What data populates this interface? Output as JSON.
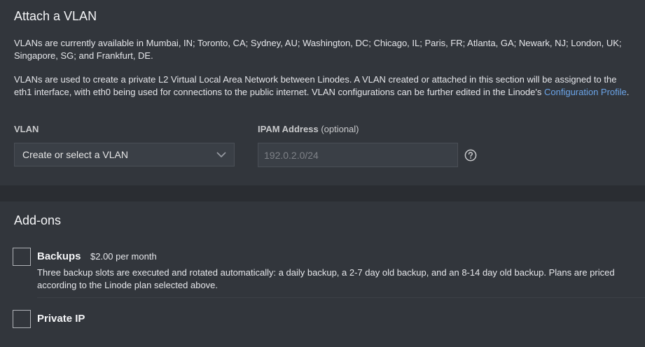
{
  "vlan": {
    "title": "Attach a VLAN",
    "availability": "VLANs are currently available in Mumbai, IN; Toronto, CA; Sydney, AU; Washington, DC; Chicago, IL; Paris, FR; Atlanta, GA; Newark, NJ; London, UK; Singapore, SG; and Frankfurt, DE.",
    "description": "VLANs are used to create a private L2 Virtual Local Area Network between Linodes. A VLAN created or attached in this section will be assigned to the eth1 interface, with eth0 being used for connections to the public internet. VLAN configurations can be further edited in the Linode's",
    "config_link": "Configuration Profile",
    "period": ".",
    "vlan_label": "VLAN",
    "select_value": "Create or select a VLAN",
    "ipam_label": "IPAM Address",
    "ipam_optional": "(optional)",
    "ipam_placeholder": "192.0.2.0/24"
  },
  "addons": {
    "title": "Add-ons",
    "backups": {
      "label": "Backups",
      "price": "$2.00 per month",
      "description": "Three backup slots are executed and rotated automatically: a daily backup, a 2-7 day old backup, and an 8-14 day old backup. Plans are priced according to the Linode plan selected above.",
      "checked": false
    },
    "private_ip": {
      "label": "Private IP",
      "checked": false
    }
  },
  "icons": {
    "select_chevron": "chevron-down-icon",
    "help": "help-circle-icon"
  },
  "colors": {
    "background": "#32363c",
    "band": "#2a2d32",
    "link": "#6ba4e8"
  }
}
